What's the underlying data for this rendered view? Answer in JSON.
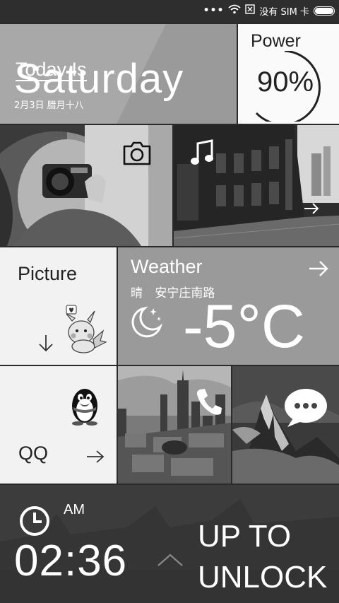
{
  "status_bar": {
    "dots": "•••",
    "sim_text": "没有 SIM 卡"
  },
  "date_tile": {
    "heading": "Today Is",
    "weekday": "Saturday",
    "lunar_date": "2月3日  腊月十八"
  },
  "power_tile": {
    "label": "Power",
    "value": "90%",
    "level": 0.9
  },
  "camera_tile": {
    "icon": "camera-icon"
  },
  "music_tile": {
    "icon": "music-note-icon",
    "arrow": "arrow-right-icon"
  },
  "picture_tile": {
    "label": "Picture",
    "icon": "pikachu-icon",
    "arrow": "arrow-down-icon"
  },
  "weather_tile": {
    "label": "Weather",
    "condition": "晴",
    "location": "安宁庄南路",
    "temperature": "-5°C",
    "icon": "moon-stars-icon"
  },
  "qq_tile": {
    "label": "QQ",
    "icon": "qq-penguin-icon",
    "arrow": "arrow-right-icon"
  },
  "phone_tile": {
    "icon": "phone-icon"
  },
  "sms_tile": {
    "icon": "chat-bubble-icon"
  },
  "lock_bar": {
    "ampm": "AM",
    "time": "02:36",
    "unlock_line1": "UP TO",
    "unlock_line2": "UNLOCK",
    "icons": [
      "clock-icon",
      "chevron-up-icon"
    ]
  },
  "colors": {
    "date_tile_bg": "#a8a8a8",
    "weather_tile_bg": "#9a9a9a",
    "light_tile_bg": "#f2f2f2",
    "lock_bar_bg": "#3c3c3c"
  }
}
